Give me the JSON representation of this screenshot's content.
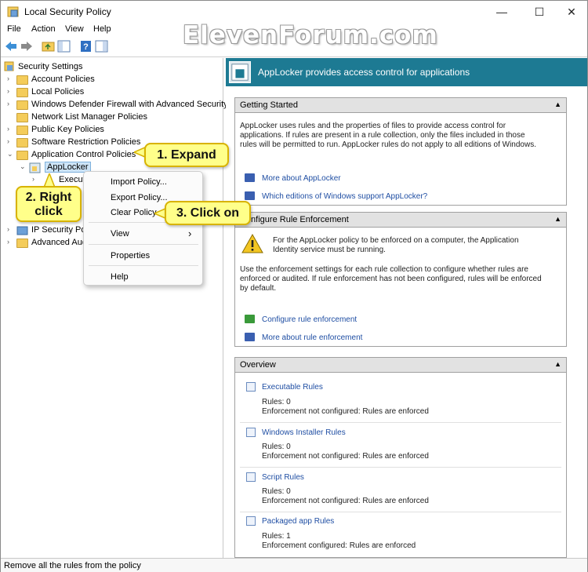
{
  "window": {
    "title": "Local Security Policy",
    "minimize": "—",
    "maximize": "☐",
    "close": "✕"
  },
  "watermark": "ElevenForum.com",
  "menu": {
    "file": "File",
    "action": "Action",
    "view": "View",
    "help": "Help"
  },
  "tree": {
    "root": "Security Settings",
    "items": [
      "Account Policies",
      "Local Policies",
      "Windows Defender Firewall with Advanced Security",
      "Network List Manager Policies",
      "Public Key Policies",
      "Software Restriction Policies",
      "Application Control Policies",
      "AppLocker",
      "Executa",
      "IP Security Poli",
      "Advanced Aud"
    ]
  },
  "banner": {
    "title": "AppLocker provides access control for applications"
  },
  "getting_started": {
    "header": "Getting Started",
    "body1": "AppLocker uses rules and the properties of files to provide access control for",
    "body2": "applications. If rules are present in a rule collection, only the files included in those",
    "body3": "rules will be permitted to run. AppLocker rules do not apply to all editions of Windows.",
    "link1": "More about AppLocker",
    "link2": "Which editions of Windows support AppLocker?"
  },
  "enforcement": {
    "header": "Configure Rule Enforcement",
    "warn1": "For the AppLocker policy to be enforced on a computer, the Application",
    "warn2": "Identity service must be running.",
    "body1": "Use the enforcement settings for each rule collection to configure whether rules are",
    "body2": "enforced or audited. If rule enforcement has not been configured, rules will be enforced",
    "body3": "by default.",
    "link1": "Configure rule enforcement",
    "link2": "More about rule enforcement"
  },
  "overview": {
    "header": "Overview",
    "rules": [
      {
        "name": "Executable Rules",
        "count": "Rules: 0",
        "status": "Enforcement not configured: Rules are enforced"
      },
      {
        "name": "Windows Installer Rules",
        "count": "Rules: 0",
        "status": "Enforcement not configured: Rules are enforced"
      },
      {
        "name": "Script Rules",
        "count": "Rules: 0",
        "status": "Enforcement not configured: Rules are enforced"
      },
      {
        "name": "Packaged app Rules",
        "count": "Rules: 1",
        "status": "Enforcement configured: Rules are enforced"
      }
    ]
  },
  "context_menu": {
    "import": "Import Policy...",
    "export": "Export Policy...",
    "clear": "Clear Policy",
    "view": "View",
    "view_arrow": "›",
    "properties": "Properties",
    "help": "Help"
  },
  "callouts": {
    "expand": "1. Expand",
    "right_click_1": "2. Right",
    "right_click_2": "click",
    "click_on": "3. Click on"
  },
  "status": "Remove all the rules from the policy",
  "colors": {
    "banner": "#1d7a93",
    "callout": "#ffff8a",
    "link": "#1f4ea3"
  }
}
